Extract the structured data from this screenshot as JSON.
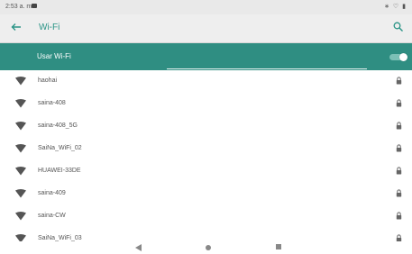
{
  "status_bar": {
    "time": "2:53 a. m.",
    "icons": "∗ ♡ ▮"
  },
  "app_bar": {
    "title": "Wi-Fi",
    "back_icon": "arrow-back",
    "search_icon": "search"
  },
  "wifi_toggle": {
    "label": "Usar Wi-Fi",
    "state": "on",
    "accent_color": "#2f8e82"
  },
  "networks": [
    {
      "name": "haohai",
      "secured": true
    },
    {
      "name": "saina-408",
      "secured": true
    },
    {
      "name": "saina-408_5G",
      "secured": true
    },
    {
      "name": "SaiNa_WiFi_02",
      "secured": true
    },
    {
      "name": "HUAWEI-33DE",
      "secured": true
    },
    {
      "name": "saina-409",
      "secured": true
    },
    {
      "name": "saina-CW",
      "secured": true
    },
    {
      "name": "SaiNa_WiFi_03",
      "secured": true
    }
  ],
  "nav_bar": {
    "back": "back-triangle",
    "home": "home-circle",
    "recents": "recents-square"
  }
}
